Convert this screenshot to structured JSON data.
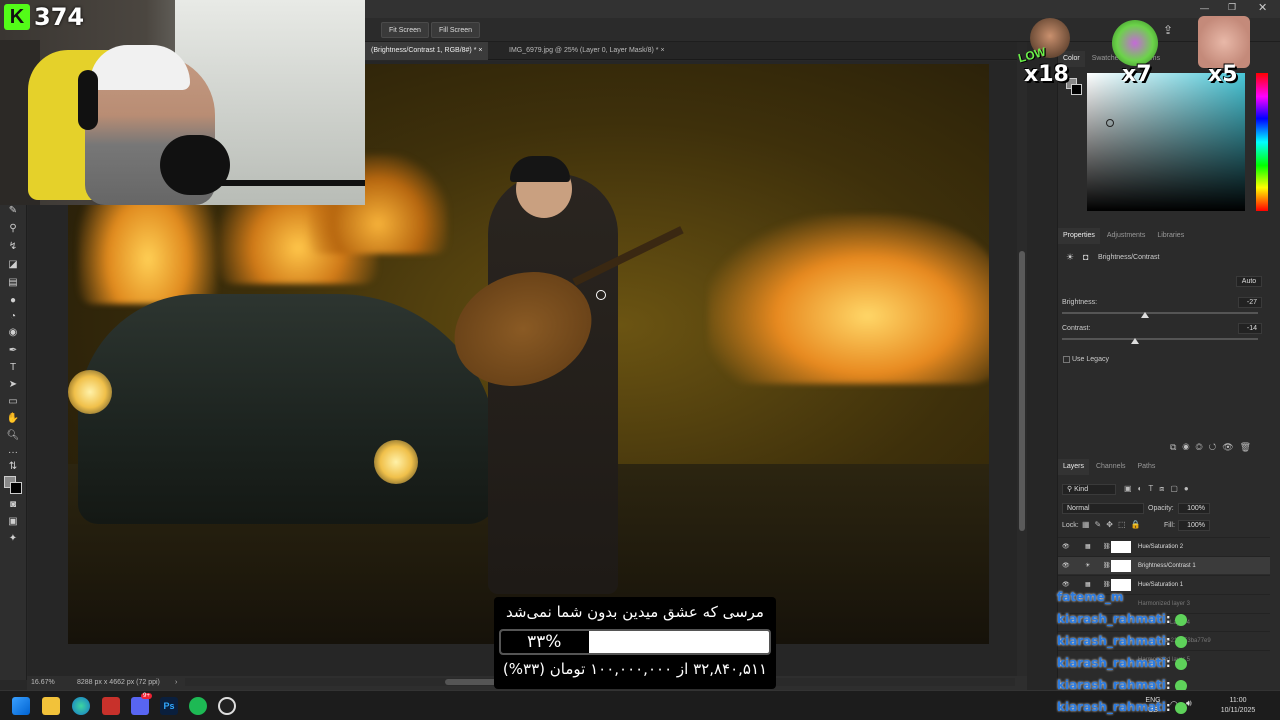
{
  "options_bar": {
    "fit_screen": "Fit Screen",
    "fill_screen": "Fill Screen"
  },
  "document_tabs": [
    {
      "label": "(Brightness/Contrast 1, RGB/8#) *",
      "active": true
    },
    {
      "label": "IMG_6979.jpg @ 25% (Layer 0, Layer Mask/8) *",
      "active": false
    }
  ],
  "status": {
    "zoom": "16.67%",
    "doc_info": "8288 px x 4662 px (72 ppi)"
  },
  "color_panel": {
    "tabs": [
      "Color",
      "Swatches",
      "Patterns"
    ],
    "accent": "#49c7d8"
  },
  "properties_panel": {
    "tabs": [
      "Properties",
      "Adjustments",
      "Libraries"
    ],
    "adjustment_name": "Brightness/Contrast",
    "auto_label": "Auto",
    "brightness_label": "Brightness:",
    "brightness_value": "-27",
    "contrast_label": "Contrast:",
    "contrast_value": "-14",
    "legacy_label": "Use Legacy"
  },
  "layers_panel": {
    "tabs": [
      "Layers",
      "Channels",
      "Paths"
    ],
    "kind_label": "Kind",
    "blend_mode": "Normal",
    "opacity_label": "Opacity:",
    "opacity_value": "100%",
    "lock_label": "Lock:",
    "fill_label": "Fill:",
    "fill_value": "100%",
    "layers": [
      {
        "name": "Hue/Saturation 2",
        "selected": false
      },
      {
        "name": "Brightness/Contrast 1",
        "selected": true
      },
      {
        "name": "Hue/Saturation 1",
        "selected": false
      },
      {
        "name": "Harmonized layer 3",
        "selected": false
      },
      {
        "name": "Layer 4",
        "selected": false
      },
      {
        "name": "ab-219253ba77e9",
        "selected": false
      },
      {
        "name": "Harmonized layer 5",
        "selected": false
      }
    ]
  },
  "stream_overlay": {
    "kick_logo": "K",
    "viewer_count": "374",
    "emotes": [
      {
        "multiplier": "x18"
      },
      {
        "multiplier": "x7"
      },
      {
        "multiplier": "x5"
      }
    ],
    "emote_text": "LOW"
  },
  "donation": {
    "title": "مرسی که عشق میدین بدون شما نمی‌شد",
    "percent_label": "۳۳%",
    "progress": 0.33,
    "amount_text": "۳۲,۸۴۰,۵۱۱ از ۱۰۰,۰۰۰,۰۰۰ تومان (۳۳%)"
  },
  "chat": [
    {
      "user": "fateme_m",
      "msg": ""
    },
    {
      "user": "kiarash_rahmati",
      "msg": ":"
    },
    {
      "user": "kiarash_rahmati",
      "msg": ":"
    },
    {
      "user": "kiarash_rahmati",
      "msg": ":"
    },
    {
      "user": "kiarash_rahmati",
      "msg": ":"
    },
    {
      "user": "kiarash_rahmati",
      "msg": ":"
    }
  ],
  "taskbar": {
    "language_top": "ENG",
    "language_bottom": "US",
    "time": "11:00",
    "date": "10/11/2025",
    "discord_badge": "9+"
  }
}
